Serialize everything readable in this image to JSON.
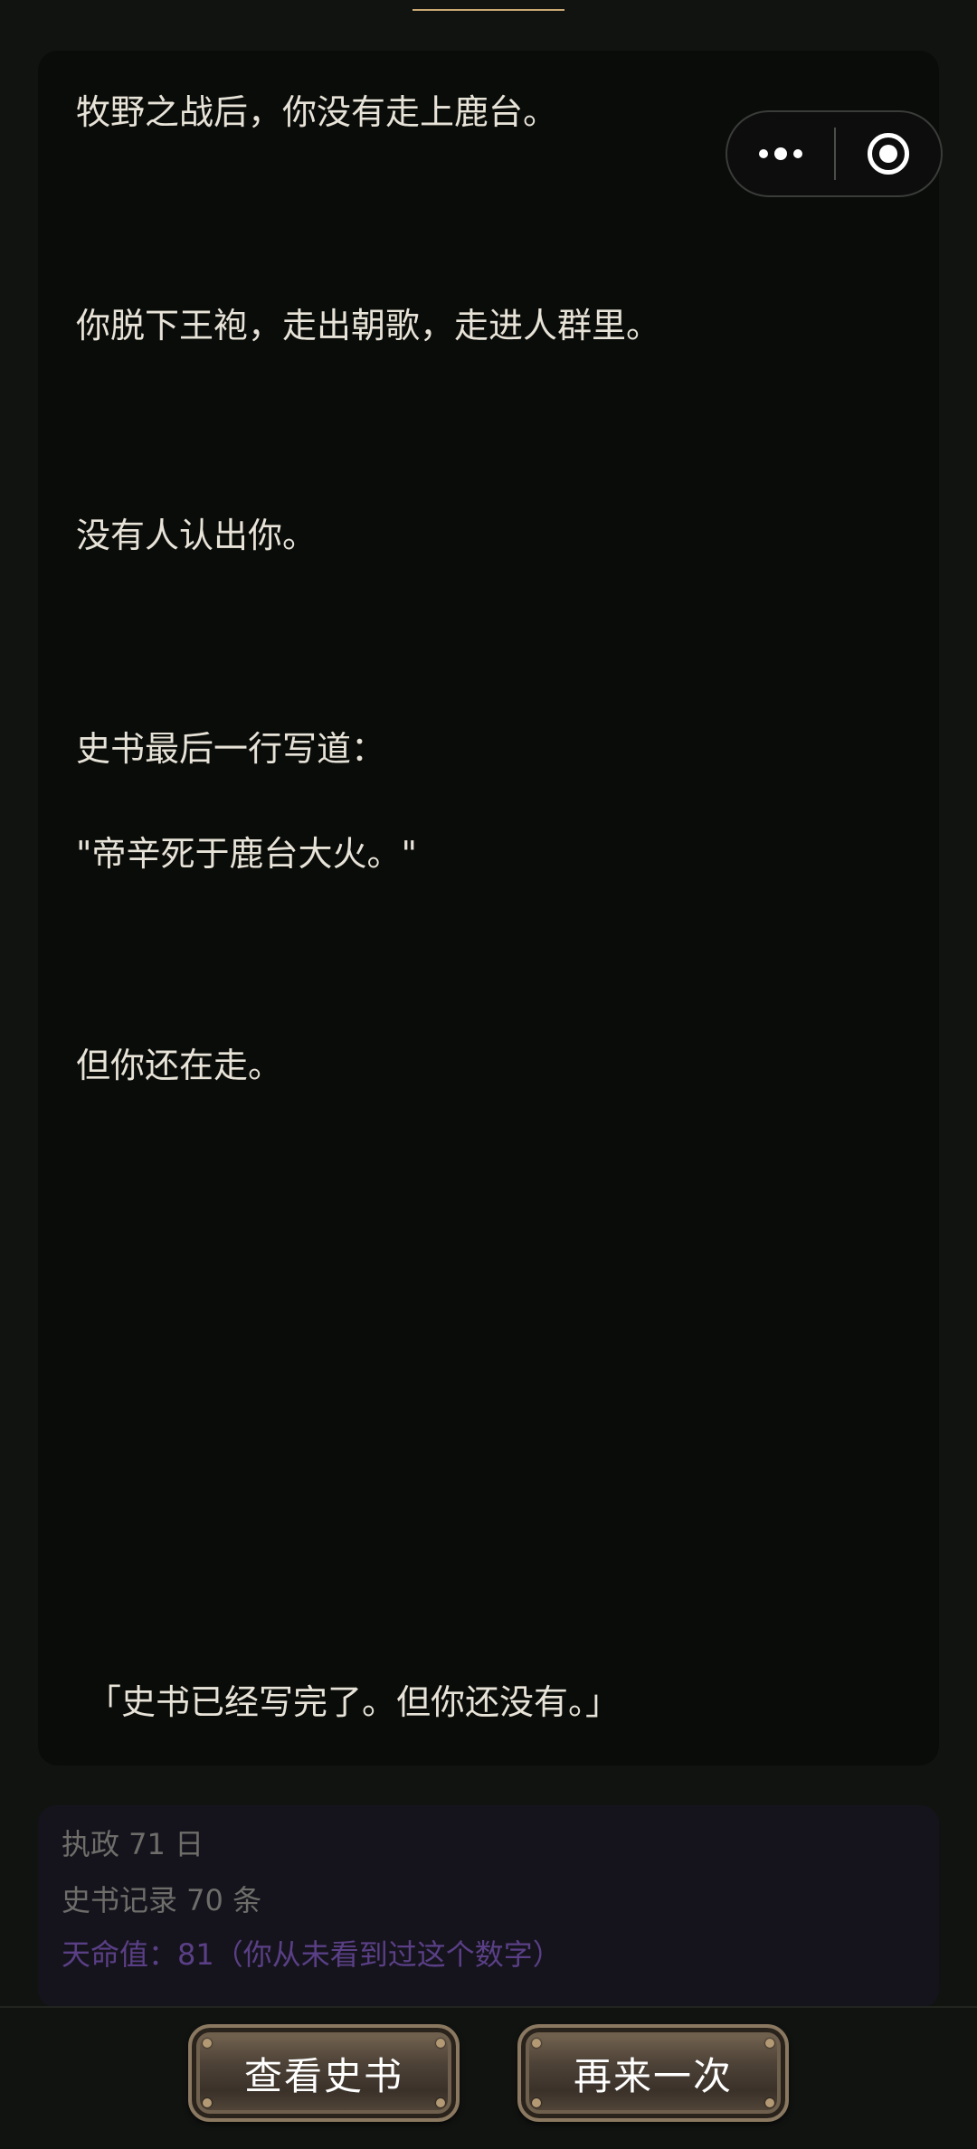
{
  "story": {
    "lines": [
      "牧野之战后，你没有走上鹿台。",
      "你脱下王袍，走出朝歌，走进人群里。",
      "没有人认出你。",
      "史书最后一行写道：",
      "\"帝辛死于鹿台大火。\"",
      "但你还在走。"
    ],
    "closing": "「史书已经写完了。但你还没有。」"
  },
  "capsule": {
    "more_icon": "more-dots-icon",
    "close_icon": "target-circle-icon"
  },
  "stats": {
    "days": "执政 71 日",
    "records": "史书记录 70 条",
    "fate": "天命值：81（你从未看到过这个数字）"
  },
  "buttons": {
    "view_history": "查看史书",
    "play_again": "再来一次"
  },
  "colors": {
    "background": "#111311",
    "card": "#0a0c09",
    "text": "#e8e3d8",
    "stats_text": "#6e6d6a",
    "fate_text": "#5a3f86",
    "accent_line": "#c9a874"
  }
}
